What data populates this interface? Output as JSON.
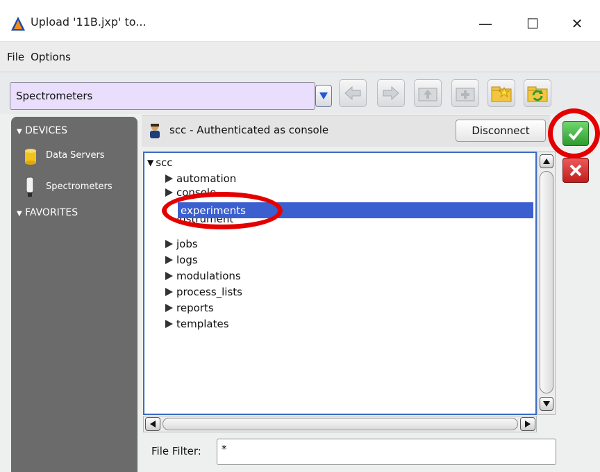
{
  "window": {
    "title": "Upload '11B.jxp' to...",
    "minimize_glyph": "—",
    "maximize_glyph": "☐",
    "close_glyph": "✕"
  },
  "menu": {
    "items": [
      "File",
      "Options"
    ]
  },
  "toolbar": {
    "location_value": "Spectrometers",
    "buttons": [
      "back-arrow-icon",
      "forward-arrow-icon",
      "up-folder-icon",
      "add-folder-icon",
      "favorite-folder-icon",
      "refresh-folder-icon"
    ]
  },
  "sidebar": {
    "devices_header": "DEVICES",
    "items": [
      {
        "label": "Data Servers",
        "icon": "database-icon"
      },
      {
        "label": "Spectrometers",
        "icon": "spectrometer-icon"
      }
    ],
    "favorites_header": "FAVORITES"
  },
  "connection": {
    "status_text": "scc - Authenticated as console",
    "disconnect_label": "Disconnect"
  },
  "tree": {
    "root": "scc",
    "children": [
      "automation",
      "console",
      "experiments",
      "instrument",
      "jobs",
      "logs",
      "modulations",
      "process_lists",
      "reports",
      "templates"
    ],
    "selected": "experiments"
  },
  "file_filter": {
    "label": "File Filter:",
    "value": "*"
  },
  "colors": {
    "selection": "#3b5fcf",
    "panel_dark": "#6b6b6b",
    "combo_bg": "#e9defb",
    "annotation_red": "#e50000",
    "ok_green": "#2e9b2e",
    "cancel_red": "#c21d1d"
  }
}
